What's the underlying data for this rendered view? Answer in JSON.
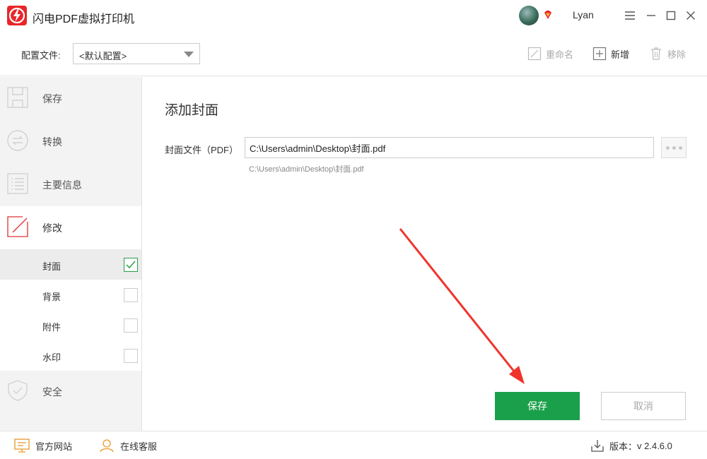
{
  "app": {
    "title": "闪电PDF虚拟打印机",
    "username": "Lyan",
    "brand_color": "#e8262a",
    "accent_color": "#1aa04a"
  },
  "window_controls": [
    {
      "name": "menu-icon"
    },
    {
      "name": "minimize-icon"
    },
    {
      "name": "maximize-icon"
    },
    {
      "name": "close-icon"
    }
  ],
  "toolbar": {
    "config_label": "配置文件:",
    "config_value": "<默认配置>",
    "rename_label": "重命名",
    "add_label": "新增",
    "remove_label": "移除"
  },
  "sidebar": {
    "items": [
      {
        "label": "保存",
        "icon": "save-icon",
        "active": false
      },
      {
        "label": "转换",
        "icon": "convert-icon",
        "active": false
      },
      {
        "label": "主要信息",
        "icon": "list-icon",
        "active": false
      },
      {
        "label": "修改",
        "icon": "edit-icon",
        "active": true
      },
      {
        "label": "安全",
        "icon": "shield-icon",
        "active": false
      }
    ],
    "sub_items": [
      {
        "label": "封面",
        "checked": true,
        "selected": true
      },
      {
        "label": "背景",
        "checked": false,
        "selected": false
      },
      {
        "label": "附件",
        "checked": false,
        "selected": false
      },
      {
        "label": "水印",
        "checked": false,
        "selected": false
      }
    ]
  },
  "main": {
    "section_title": "添加封面",
    "field_label": "封面文件（PDF）",
    "path_value": "C:\\Users\\admin\\Desktop\\封面.pdf",
    "path_hint": "C:\\Users\\admin\\Desktop\\封面.pdf",
    "save_label": "保存",
    "cancel_label": "取消"
  },
  "footer": {
    "website_label": "官方网站",
    "support_label": "在线客服",
    "version_label": "版本：",
    "version_value": "v 2.4.6.0"
  }
}
